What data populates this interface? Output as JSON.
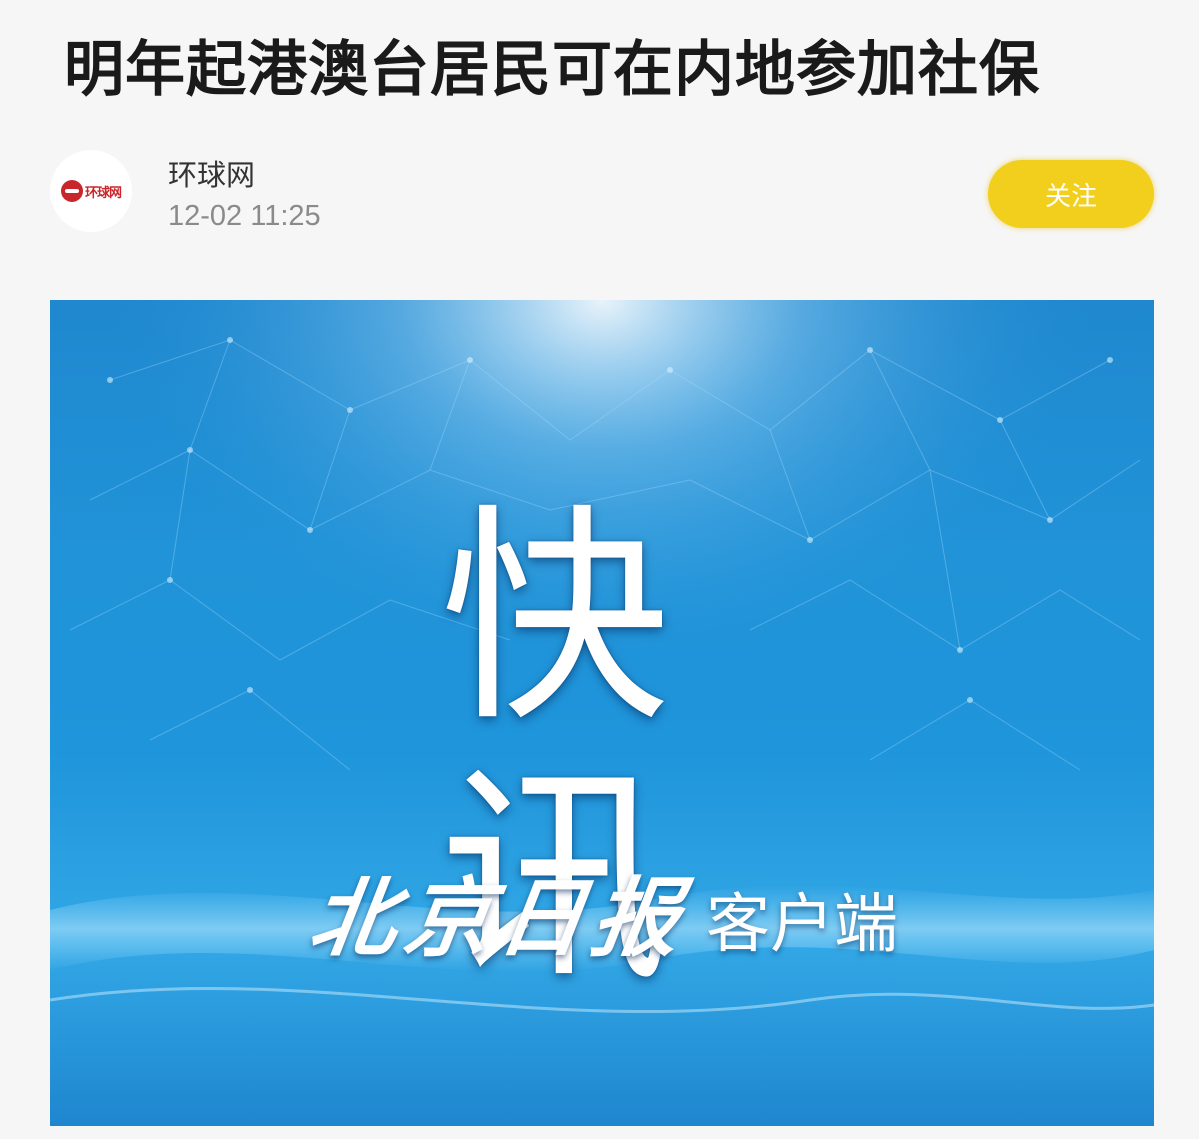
{
  "article": {
    "headline": "明年起港澳台居民可在内地参加社保"
  },
  "author": {
    "avatar_icon": "huanqiu-logo-icon",
    "logo_text": "环球网",
    "name": "环球网",
    "time": "12-02 11:25",
    "follow_label": "关注"
  },
  "banner": {
    "title": "快讯",
    "brand_calligraphy": "北京日报",
    "brand_suffix": "客户端"
  },
  "colors": {
    "follow_button": "#f2cf1c",
    "banner_blue": "#1f8fd6"
  }
}
